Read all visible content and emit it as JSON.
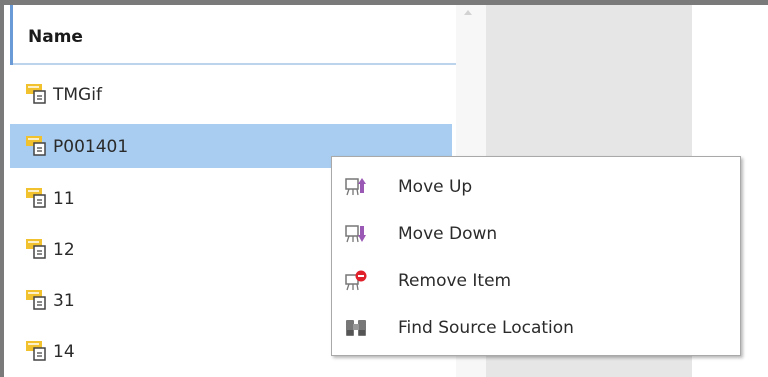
{
  "list": {
    "header": "Name",
    "items": [
      {
        "label": "TMGif",
        "icon": "document-link-icon",
        "selected": false
      },
      {
        "label": "P001401",
        "icon": "document-link-icon",
        "selected": true
      },
      {
        "label": "11",
        "icon": "document-link-icon",
        "selected": false
      },
      {
        "label": "12",
        "icon": "document-link-icon",
        "selected": false
      },
      {
        "label": "31",
        "icon": "document-link-icon",
        "selected": false
      },
      {
        "label": "14",
        "icon": "document-link-icon",
        "selected": false
      }
    ]
  },
  "context_menu": {
    "items": [
      {
        "label": "Move Up",
        "icon": "move-up-icon"
      },
      {
        "label": "Move Down",
        "icon": "move-down-icon"
      },
      {
        "label": "Remove Item",
        "icon": "remove-item-icon"
      },
      {
        "label": "Find Source Location",
        "icon": "binoculars-icon"
      }
    ]
  },
  "colors": {
    "selection": "#a9cdf0",
    "icon_yellow": "#f2c12e",
    "accent_purple": "#9b59b6",
    "remove_red": "#e0202a",
    "panel_grey": "#e6e6e6"
  }
}
